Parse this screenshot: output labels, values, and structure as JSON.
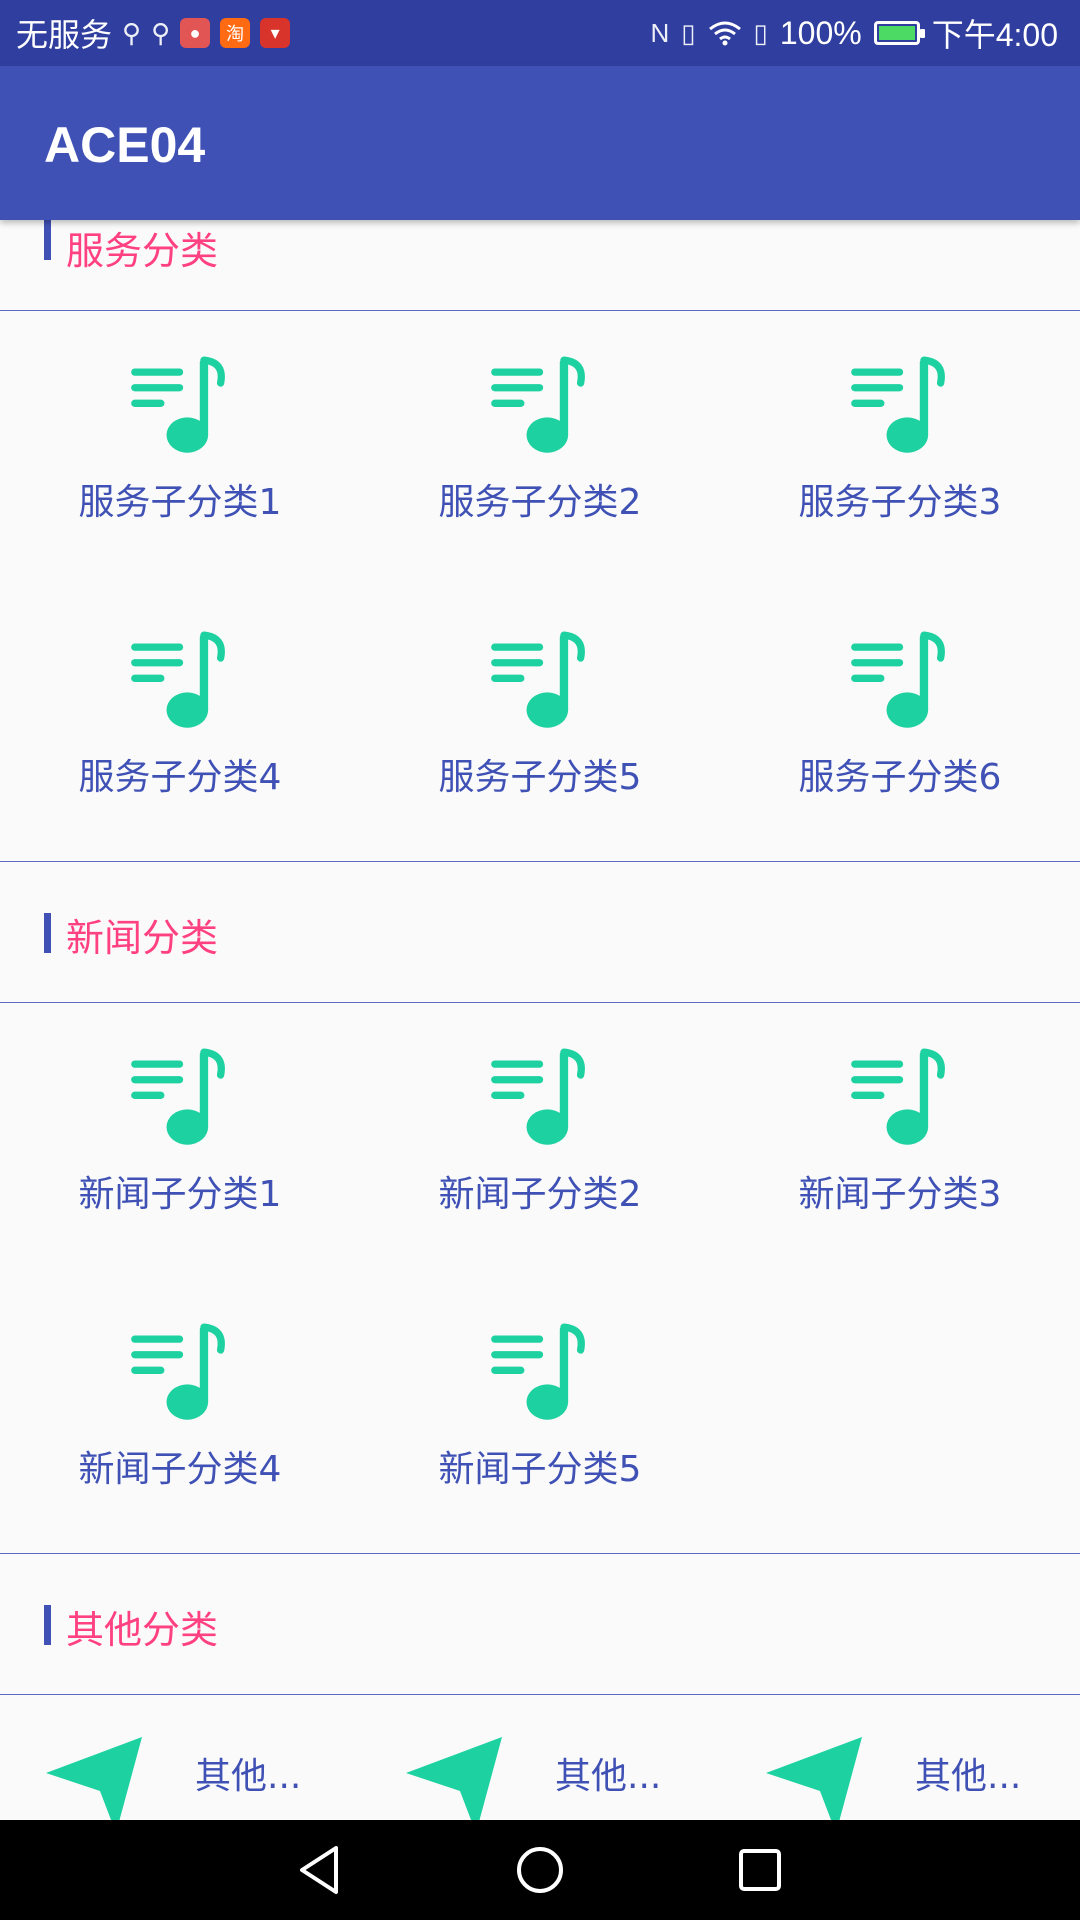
{
  "status_bar": {
    "carrier": "无服务",
    "app_badges": [
      "淘"
    ],
    "battery": "100%",
    "time": "下午4:00",
    "icons": [
      "usb-icon",
      "usb-icon",
      "app-badge-icon",
      "taobao-icon",
      "app-badge-icon",
      "nfc-icon",
      "vibrate-icon",
      "wifi-icon",
      "sim-icon",
      "battery-icon"
    ]
  },
  "app_bar": {
    "title": "ACE04"
  },
  "sections": {
    "service": {
      "title": "服务分类",
      "items": [
        "服务子分类1",
        "服务子分类2",
        "服务子分类3",
        "服务子分类4",
        "服务子分类5",
        "服务子分类6"
      ]
    },
    "news": {
      "title": "新闻分类",
      "items": [
        "新闻子分类1",
        "新闻子分类2",
        "新闻子分类3",
        "新闻子分类4",
        "新闻子分类5"
      ]
    },
    "other": {
      "title": "其他分类",
      "items": [
        "其他...",
        "其他...",
        "其他..."
      ]
    }
  },
  "colors": {
    "primary": "#3f51b5",
    "primary_dark": "#303f9f",
    "accent": "#ff4081",
    "icon": "#1dd1a1"
  },
  "nav": {
    "icons": [
      "back-icon",
      "home-icon",
      "recents-icon"
    ]
  }
}
